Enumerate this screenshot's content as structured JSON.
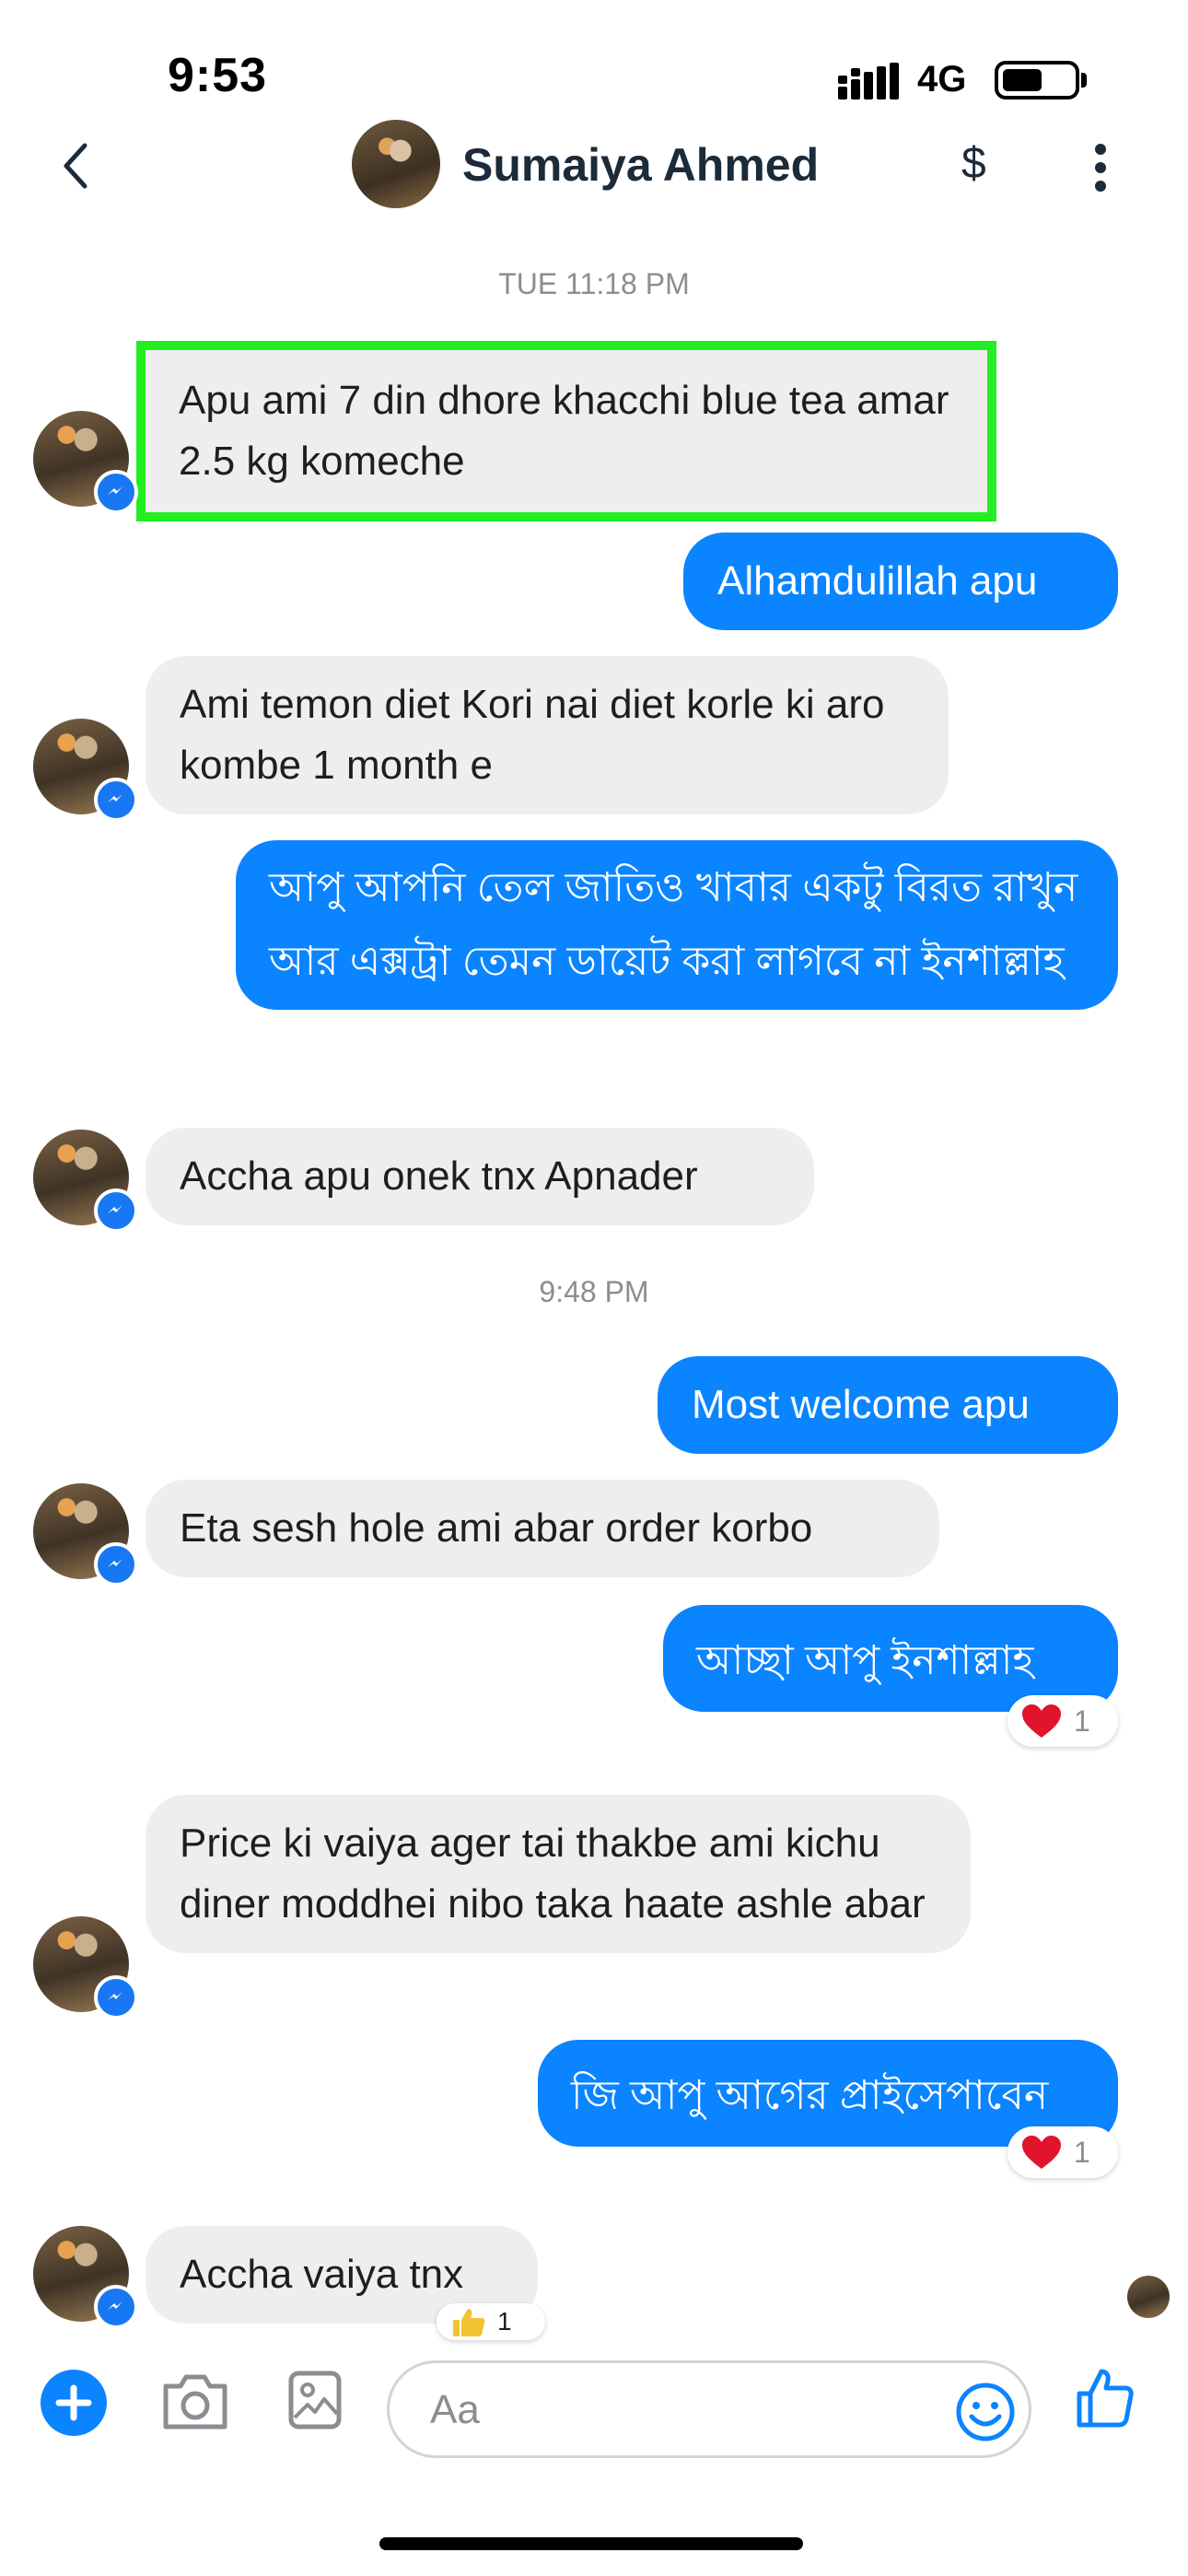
{
  "status_bar": {
    "time": "9:53",
    "network": "4G"
  },
  "header": {
    "contact_name": "Sumaiya Ahmed",
    "dollar_label": "$"
  },
  "timestamps": [
    "TUE 11:18 PM",
    "9:48 PM"
  ],
  "messages": [
    {
      "from": "them",
      "text": "Apu ami 7 din dhore khacchi blue tea amar 2.5 kg komeche",
      "highlighted": true
    },
    {
      "from": "me",
      "text": "Alhamdulillah apu"
    },
    {
      "from": "them",
      "text": "Ami temon diet Kori nai diet korle ki aro kombe 1 month e"
    },
    {
      "from": "me",
      "text": "আপু আপনি তেল জাতিও খাবার একটু বিরত রাখুন আর এক্সট্রা তেমন ডায়েট করা লাগবে না ইনশাল্লাহ"
    },
    {
      "from": "them",
      "text": "Accha apu onek tnx Apnader"
    },
    {
      "from": "me",
      "text": "Most welcome apu"
    },
    {
      "from": "them",
      "text": "Eta sesh hole ami abar order korbo"
    },
    {
      "from": "me",
      "text": "আচ্ছা আপু ইনশাল্লাহ",
      "reaction": {
        "icon": "heart-icon",
        "count": "1"
      }
    },
    {
      "from": "them",
      "text": "Price ki vaiya ager tai thakbe ami kichu diner moddhei nibo taka haate ashle abar"
    },
    {
      "from": "me",
      "text": "জি আপু আগের প্রাইসেপাবেন",
      "reaction": {
        "icon": "heart-icon",
        "count": "1"
      }
    },
    {
      "from": "them",
      "text": "Accha vaiya tnx",
      "reaction": {
        "icon": "thumbs-up-icon",
        "count": "1"
      }
    }
  ],
  "composer": {
    "placeholder": "Aa"
  },
  "colors": {
    "outgoing": "#0b84ff",
    "incoming": "#eeeeee",
    "highlight": "#22ee22",
    "accent": "#1877f2"
  }
}
